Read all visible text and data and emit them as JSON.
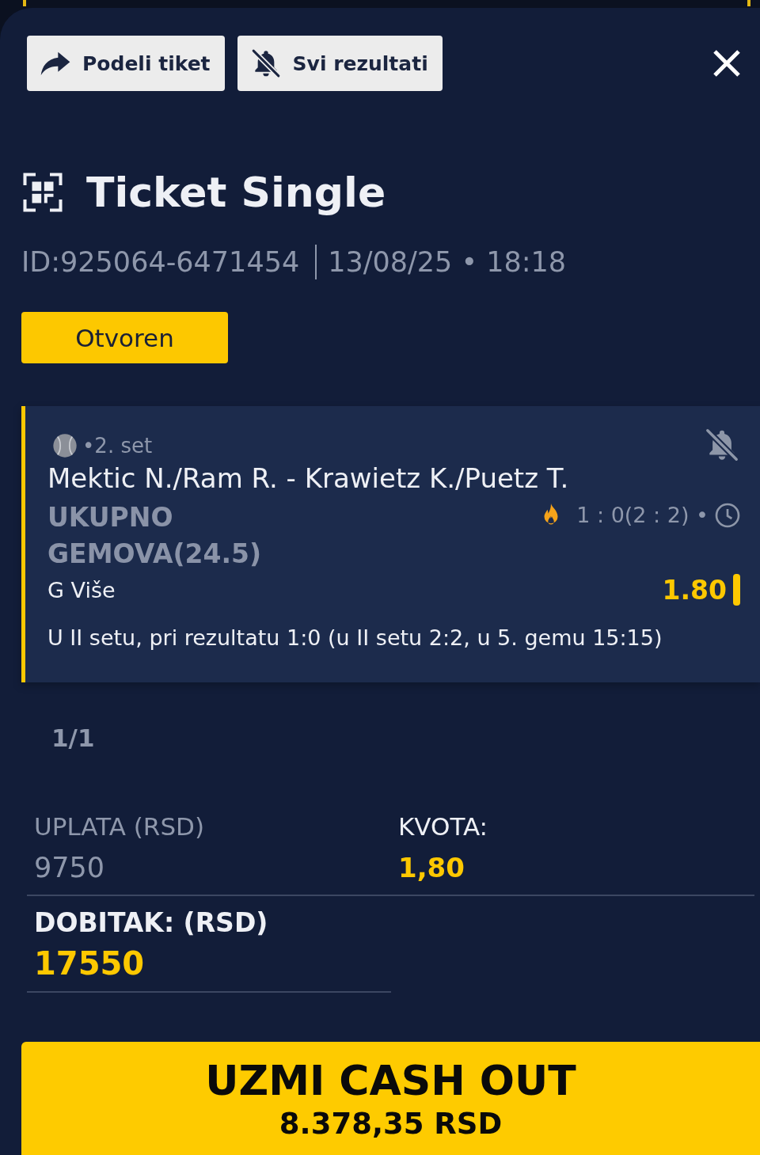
{
  "toolbar": {
    "buttons": [
      {
        "label": "Podeli tiket"
      },
      {
        "label": "Svi rezultati"
      }
    ]
  },
  "ticket": {
    "title": "Ticket Single",
    "id": "ID:925064-6471454",
    "datetime": "13/08/25 • 18:18",
    "status": "Otvoren"
  },
  "selections": [
    {
      "period": "•2. set",
      "match": "Mektic N./Ram R. - Krawietz K./Puetz T.",
      "market": "UKUPNO GEMOVA(24.5)",
      "score": "1 : 0(2 : 2) •",
      "pick": "G Više",
      "odds": "1.80",
      "note": "U II setu, pri rezultatu 1:0 (u II setu 2:2, u 5. gemu 15:15)",
      "muted": true
    }
  ],
  "pager": "1/1",
  "summary": {
    "stake_label": "UPLATA (RSD)",
    "stake": "9750",
    "odds_label": "KVOTA:",
    "odds": "1,80",
    "win_label": "DOBITAK: (RSD)",
    "win": "17550"
  },
  "cash_out": {
    "label": "UZMI CASH OUT",
    "amount": "8.378,35 RSD"
  }
}
